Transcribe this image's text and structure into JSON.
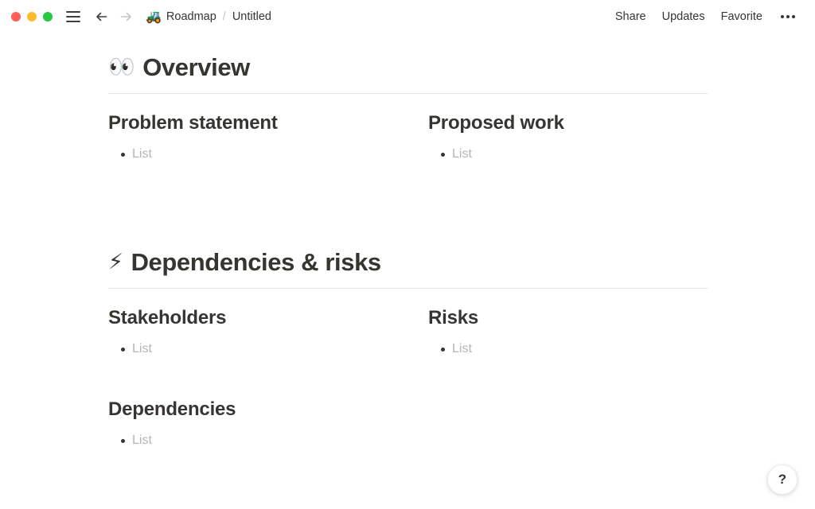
{
  "window": {
    "traffic_lights": [
      {
        "name": "close",
        "color": "#ff5f57"
      },
      {
        "name": "minimize",
        "color": "#febc2e"
      },
      {
        "name": "maximize",
        "color": "#28c840"
      }
    ],
    "sidebar_toggle_icon": "hamburger-icon",
    "back_icon": "arrow-left-icon",
    "forward_icon": "arrow-right-icon"
  },
  "breadcrumb": {
    "emoji": "🚜",
    "parent": "Roadmap",
    "separator": "/",
    "current": "Untitled"
  },
  "toolbar": {
    "share_label": "Share",
    "updates_label": "Updates",
    "favorite_label": "Favorite",
    "more_label": "•••"
  },
  "sections": [
    {
      "emoji": "👀",
      "title": "Overview",
      "columns": [
        {
          "title": "Problem statement",
          "items": [
            "List"
          ]
        },
        {
          "title": "Proposed work",
          "items": [
            "List"
          ]
        }
      ]
    },
    {
      "emoji": "⚡",
      "title": "Dependencies & risks",
      "columns": [
        {
          "title": "Stakeholders",
          "items": [
            "List"
          ]
        },
        {
          "title": "Risks",
          "items": [
            "List"
          ]
        }
      ],
      "extra": {
        "title": "Dependencies",
        "items": [
          "List"
        ]
      }
    }
  ],
  "help": {
    "label": "?"
  },
  "colors": {
    "text": "#37352f",
    "placeholder": "#b6b5b2",
    "divider": "#e9e9e7",
    "background": "#ffffff"
  }
}
